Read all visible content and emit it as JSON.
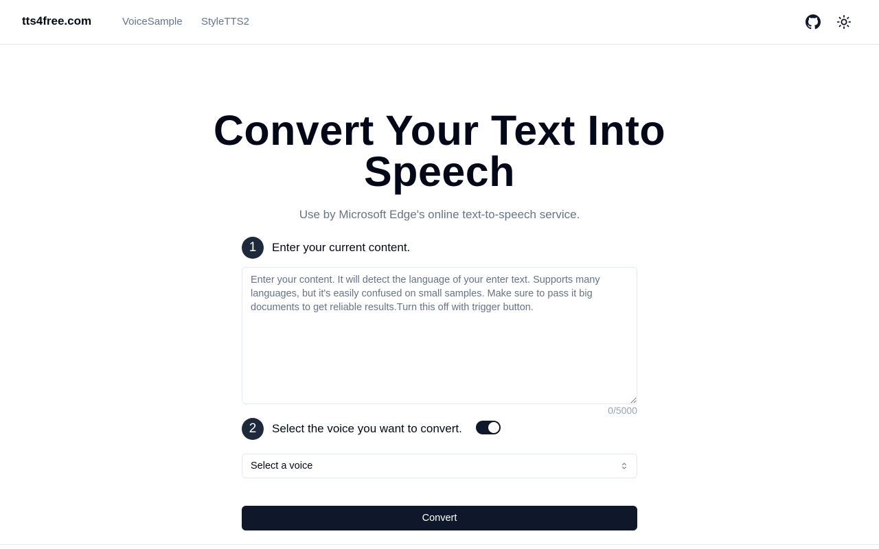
{
  "header": {
    "brand": "tts4free.com",
    "nav": [
      {
        "label": "VoiceSample"
      },
      {
        "label": "StyleTTS2"
      }
    ],
    "icons": [
      "github-icon",
      "sun-icon"
    ]
  },
  "hero": {
    "title": "Convert Your Text Into Speech",
    "subtitle": "Use by Microsoft Edge's online text-to-speech service."
  },
  "step1": {
    "number": "1",
    "label": "Enter your current content.",
    "placeholder": "Enter your content. It will detect the language of your enter text. Supports many languages, but it's easily confused on small samples. Make sure to pass it big documents to get reliable results.Turn this off with trigger button.",
    "value": "",
    "char_count": "0/5000"
  },
  "step2": {
    "number": "2",
    "label": "Select the voice you want to convert.",
    "auto_detect_toggle": true,
    "select_placeholder": "Select a voice",
    "select_icon": "chevron-up-down-icon"
  },
  "convert": {
    "label": "Convert"
  },
  "colors": {
    "primary": "#0f172a",
    "muted_text": "#64748b",
    "border": "#e2e8f0",
    "step_badge": "#1e293b"
  }
}
